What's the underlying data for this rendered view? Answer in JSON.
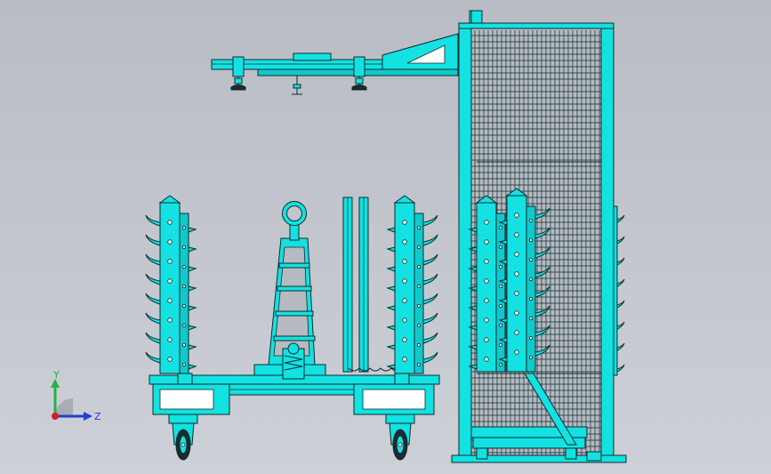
{
  "triad": {
    "y_label": "Y",
    "z_label": "Z",
    "colors": {
      "y": "#21b24b",
      "z": "#1f3fd8",
      "origin": "#d21e28"
    }
  },
  "model_colors": {
    "body": "#14e1e1",
    "outline": "#0c2c30",
    "background": "#c2c5cc"
  }
}
